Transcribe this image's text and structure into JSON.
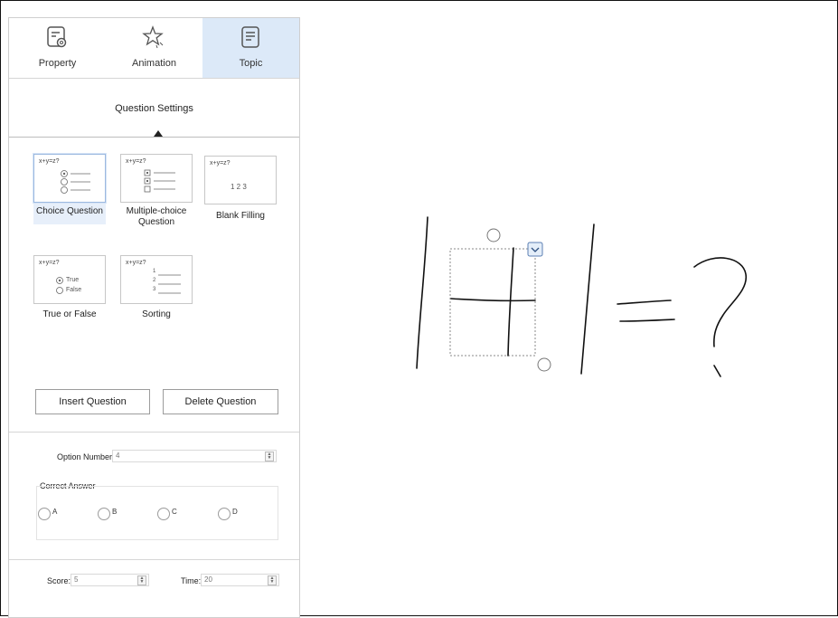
{
  "tabs": [
    {
      "label": "Property",
      "icon": "settings-document-icon",
      "active": false
    },
    {
      "label": "Animation",
      "icon": "star-icon",
      "active": false
    },
    {
      "label": "Topic",
      "icon": "document-icon",
      "active": true
    }
  ],
  "question_settings": {
    "title": "Question Settings"
  },
  "question_types": [
    {
      "label": "Choice Question",
      "preview": "x+y=z?",
      "selected": true
    },
    {
      "label": "Multiple-choice Question",
      "preview": "x+y=z?",
      "selected": false
    },
    {
      "label": "Blank Filling",
      "preview": "x+y=z?",
      "preview_numbers": "1  2  3",
      "selected": false
    },
    {
      "label": "True or False",
      "preview": "x+y=z?",
      "options": [
        "True",
        "False"
      ],
      "selected": false
    },
    {
      "label": "Sorting",
      "preview": "x+y=z?",
      "numbers": [
        "1",
        "2",
        "3"
      ],
      "selected": false
    }
  ],
  "actions": {
    "insert": "Insert Question",
    "delete": "Delete Question"
  },
  "option_number": {
    "label": "Option Number:",
    "value": "4"
  },
  "correct_answer": {
    "label": "Correct Answer",
    "options": [
      "A",
      "B",
      "C",
      "D"
    ]
  },
  "score": {
    "label": "Score:",
    "value": "5"
  },
  "time": {
    "label": "Time:",
    "value": "20"
  },
  "colors": {
    "active_tab": "#dce9f8",
    "selected_card": "#e7effa",
    "accent": "#5b7fb3"
  }
}
